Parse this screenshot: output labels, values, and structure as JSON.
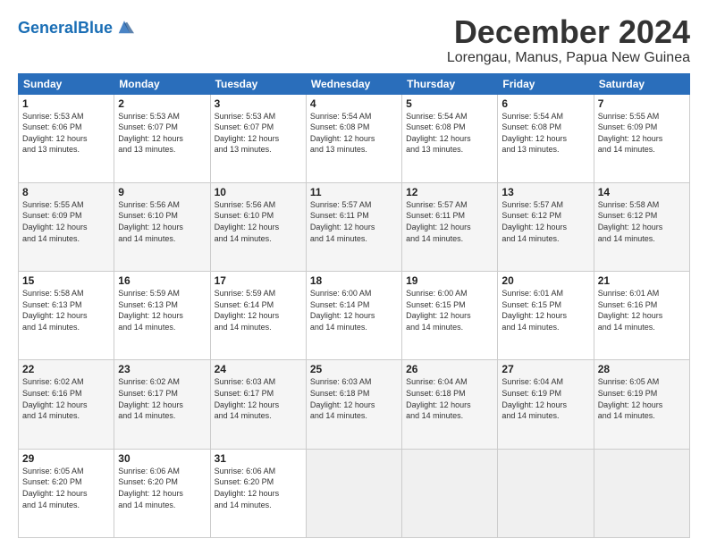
{
  "header": {
    "logo_general": "General",
    "logo_blue": "Blue",
    "month_title": "December 2024",
    "location": "Lorengau, Manus, Papua New Guinea"
  },
  "weekdays": [
    "Sunday",
    "Monday",
    "Tuesday",
    "Wednesday",
    "Thursday",
    "Friday",
    "Saturday"
  ],
  "weeks": [
    [
      {
        "day": "1",
        "info": "Sunrise: 5:53 AM\nSunset: 6:06 PM\nDaylight: 12 hours\nand 13 minutes."
      },
      {
        "day": "2",
        "info": "Sunrise: 5:53 AM\nSunset: 6:07 PM\nDaylight: 12 hours\nand 13 minutes."
      },
      {
        "day": "3",
        "info": "Sunrise: 5:53 AM\nSunset: 6:07 PM\nDaylight: 12 hours\nand 13 minutes."
      },
      {
        "day": "4",
        "info": "Sunrise: 5:54 AM\nSunset: 6:08 PM\nDaylight: 12 hours\nand 13 minutes."
      },
      {
        "day": "5",
        "info": "Sunrise: 5:54 AM\nSunset: 6:08 PM\nDaylight: 12 hours\nand 13 minutes."
      },
      {
        "day": "6",
        "info": "Sunrise: 5:54 AM\nSunset: 6:08 PM\nDaylight: 12 hours\nand 13 minutes."
      },
      {
        "day": "7",
        "info": "Sunrise: 5:55 AM\nSunset: 6:09 PM\nDaylight: 12 hours\nand 14 minutes."
      }
    ],
    [
      {
        "day": "8",
        "info": "Sunrise: 5:55 AM\nSunset: 6:09 PM\nDaylight: 12 hours\nand 14 minutes."
      },
      {
        "day": "9",
        "info": "Sunrise: 5:56 AM\nSunset: 6:10 PM\nDaylight: 12 hours\nand 14 minutes."
      },
      {
        "day": "10",
        "info": "Sunrise: 5:56 AM\nSunset: 6:10 PM\nDaylight: 12 hours\nand 14 minutes."
      },
      {
        "day": "11",
        "info": "Sunrise: 5:57 AM\nSunset: 6:11 PM\nDaylight: 12 hours\nand 14 minutes."
      },
      {
        "day": "12",
        "info": "Sunrise: 5:57 AM\nSunset: 6:11 PM\nDaylight: 12 hours\nand 14 minutes."
      },
      {
        "day": "13",
        "info": "Sunrise: 5:57 AM\nSunset: 6:12 PM\nDaylight: 12 hours\nand 14 minutes."
      },
      {
        "day": "14",
        "info": "Sunrise: 5:58 AM\nSunset: 6:12 PM\nDaylight: 12 hours\nand 14 minutes."
      }
    ],
    [
      {
        "day": "15",
        "info": "Sunrise: 5:58 AM\nSunset: 6:13 PM\nDaylight: 12 hours\nand 14 minutes."
      },
      {
        "day": "16",
        "info": "Sunrise: 5:59 AM\nSunset: 6:13 PM\nDaylight: 12 hours\nand 14 minutes."
      },
      {
        "day": "17",
        "info": "Sunrise: 5:59 AM\nSunset: 6:14 PM\nDaylight: 12 hours\nand 14 minutes."
      },
      {
        "day": "18",
        "info": "Sunrise: 6:00 AM\nSunset: 6:14 PM\nDaylight: 12 hours\nand 14 minutes."
      },
      {
        "day": "19",
        "info": "Sunrise: 6:00 AM\nSunset: 6:15 PM\nDaylight: 12 hours\nand 14 minutes."
      },
      {
        "day": "20",
        "info": "Sunrise: 6:01 AM\nSunset: 6:15 PM\nDaylight: 12 hours\nand 14 minutes."
      },
      {
        "day": "21",
        "info": "Sunrise: 6:01 AM\nSunset: 6:16 PM\nDaylight: 12 hours\nand 14 minutes."
      }
    ],
    [
      {
        "day": "22",
        "info": "Sunrise: 6:02 AM\nSunset: 6:16 PM\nDaylight: 12 hours\nand 14 minutes."
      },
      {
        "day": "23",
        "info": "Sunrise: 6:02 AM\nSunset: 6:17 PM\nDaylight: 12 hours\nand 14 minutes."
      },
      {
        "day": "24",
        "info": "Sunrise: 6:03 AM\nSunset: 6:17 PM\nDaylight: 12 hours\nand 14 minutes."
      },
      {
        "day": "25",
        "info": "Sunrise: 6:03 AM\nSunset: 6:18 PM\nDaylight: 12 hours\nand 14 minutes."
      },
      {
        "day": "26",
        "info": "Sunrise: 6:04 AM\nSunset: 6:18 PM\nDaylight: 12 hours\nand 14 minutes."
      },
      {
        "day": "27",
        "info": "Sunrise: 6:04 AM\nSunset: 6:19 PM\nDaylight: 12 hours\nand 14 minutes."
      },
      {
        "day": "28",
        "info": "Sunrise: 6:05 AM\nSunset: 6:19 PM\nDaylight: 12 hours\nand 14 minutes."
      }
    ],
    [
      {
        "day": "29",
        "info": "Sunrise: 6:05 AM\nSunset: 6:20 PM\nDaylight: 12 hours\nand 14 minutes."
      },
      {
        "day": "30",
        "info": "Sunrise: 6:06 AM\nSunset: 6:20 PM\nDaylight: 12 hours\nand 14 minutes."
      },
      {
        "day": "31",
        "info": "Sunrise: 6:06 AM\nSunset: 6:20 PM\nDaylight: 12 hours\nand 14 minutes."
      },
      null,
      null,
      null,
      null
    ]
  ]
}
